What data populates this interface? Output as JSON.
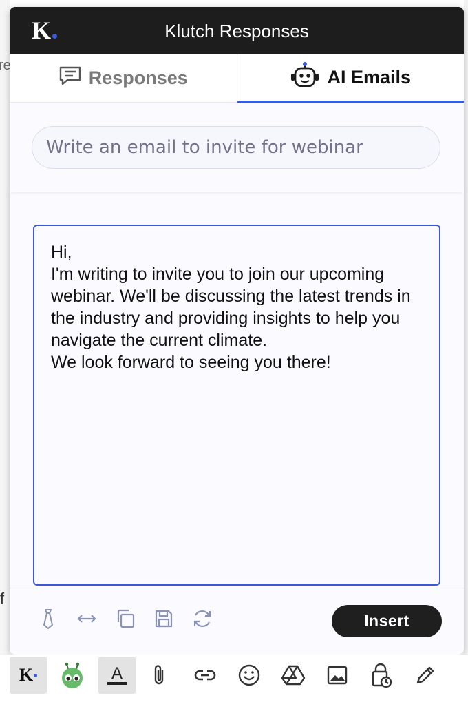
{
  "background": {
    "left_fragment_top": "re",
    "left_fragment_bottom": "f"
  },
  "popup": {
    "logo_letter": "K",
    "title": "Klutch Responses",
    "tabs": [
      {
        "label": "Responses",
        "icon": "chat-bubble-icon",
        "active": false
      },
      {
        "label": "AI Emails",
        "icon": "robot-icon",
        "active": true
      }
    ],
    "prompt_value": "Write an email to invite for webinar",
    "email_body": "Hi,\nI'm writing to invite you to join our upcoming webinar. We'll be discussing the latest trends in the industry and providing insights to help you navigate the current climate.\nWe look forward to seeing you there!",
    "tool_icons": [
      "tie-icon",
      "expand-horizontal-icon",
      "copy-icon",
      "save-icon",
      "refresh-icon"
    ],
    "insert_label": "Insert"
  },
  "compose_toolbar": {
    "logo_letter": "K",
    "icons": [
      "klutch-logo-icon",
      "bot-extension-icon",
      "text-format-icon",
      "attachment-icon",
      "link-icon",
      "emoji-icon",
      "drive-icon",
      "image-icon",
      "confidential-lock-icon",
      "signature-pen-icon"
    ]
  },
  "colors": {
    "accent": "#3b5bdb",
    "header_bg": "#1d1d1d",
    "insert_bg": "#1f1f1f"
  }
}
